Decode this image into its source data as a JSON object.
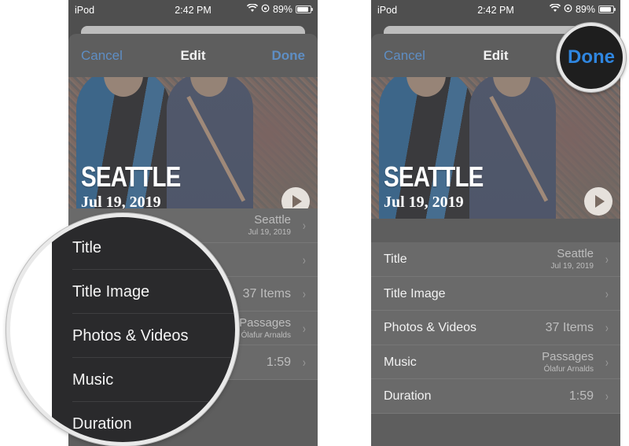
{
  "status_bar": {
    "carrier": "iPod",
    "time": "2:42 PM",
    "battery": "89%",
    "battery_level": 0.89,
    "icons": [
      "wifi-icon",
      "orientation-lock-icon",
      "battery-icon"
    ]
  },
  "nav": {
    "cancel": "Cancel",
    "title": "Edit",
    "done": "Done"
  },
  "hero": {
    "title": "SEATTLE",
    "date": "Jul 19, 2019",
    "play_icon": "play-icon"
  },
  "rows": [
    {
      "label": "Title",
      "value": "Seattle",
      "sub": "Jul 19, 2019"
    },
    {
      "label": "Title Image",
      "value": "",
      "sub": ""
    },
    {
      "label": "Photos & Videos",
      "value": "37 Items",
      "sub": ""
    },
    {
      "label": "Music",
      "value": "Passages",
      "sub": "Ólafur Arnalds"
    },
    {
      "label": "Duration",
      "value": "1:59",
      "sub": ""
    }
  ],
  "chevron": "›",
  "magnifier_left": {
    "items": [
      "Title",
      "Title Image",
      "Photos & Videos",
      "Music",
      "Duration"
    ]
  },
  "magnifier_right": {
    "label": "Done"
  },
  "colors": {
    "accent": "#2f86e0",
    "dim_accent": "#5e8ec4",
    "sheet": "#5e5e5e",
    "list": "#6a6a6a"
  }
}
